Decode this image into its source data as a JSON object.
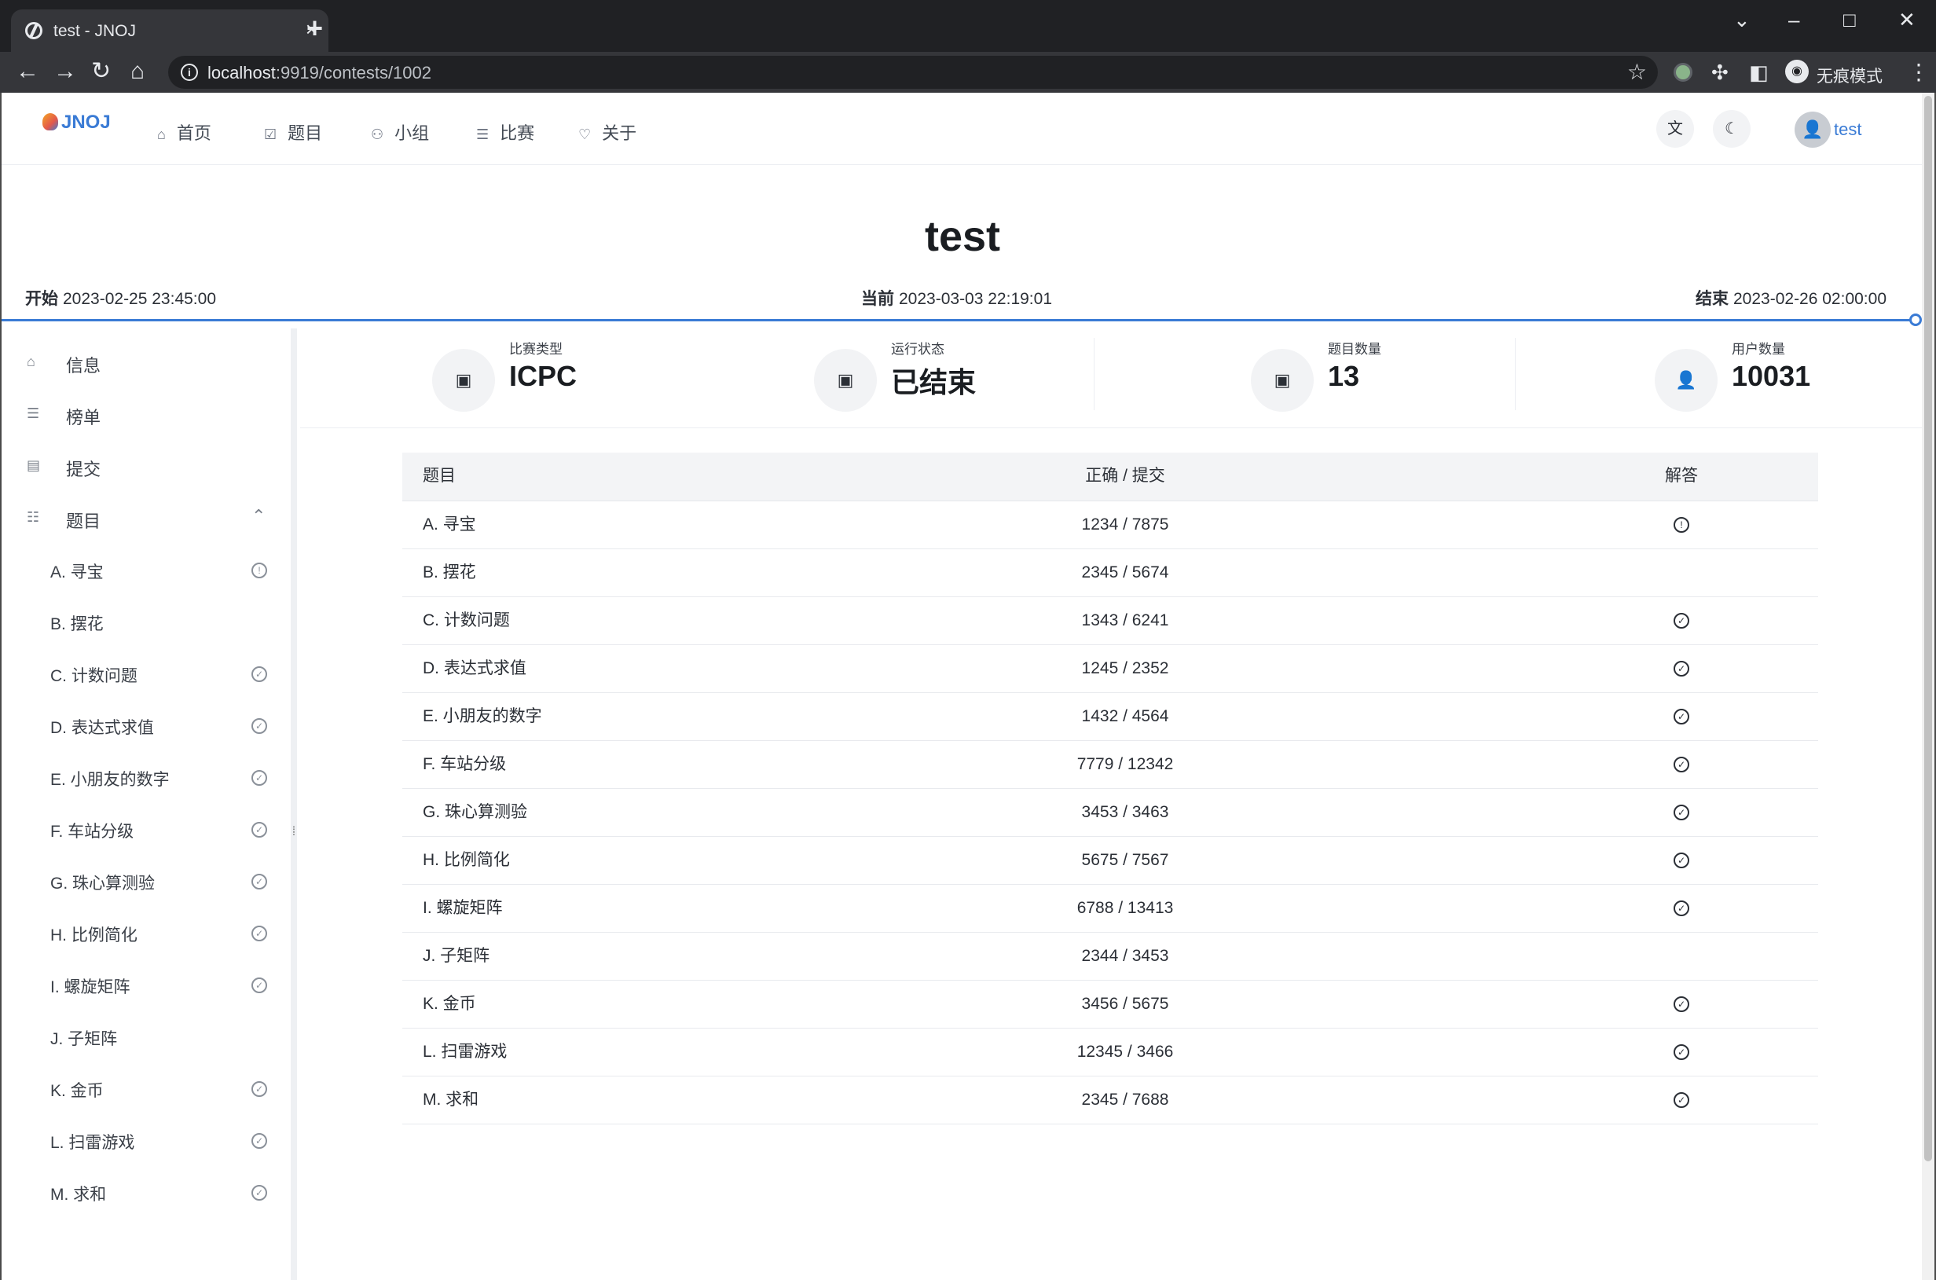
{
  "browser": {
    "tab_title": "test - JNOJ",
    "url_host": "localhost",
    "url_rest": ":9919/contests/1002",
    "incognito_label": "无痕模式"
  },
  "nav": {
    "logo": "JNOJ",
    "items": [
      {
        "label": "首页",
        "icon": "home-icon"
      },
      {
        "label": "题目",
        "icon": "list-check-icon"
      },
      {
        "label": "小组",
        "icon": "group-icon"
      },
      {
        "label": "比赛",
        "icon": "list-icon"
      },
      {
        "label": "关于",
        "icon": "heart-icon"
      }
    ],
    "user": "test"
  },
  "contest": {
    "title": "test",
    "start_label": "开始",
    "start_time": "2023-02-25 23:45:00",
    "current_label": "当前",
    "current_time": "2023-03-03 22:19:01",
    "end_label": "结束",
    "end_time": "2023-02-26 02:00:00"
  },
  "sidebar": {
    "items": [
      {
        "label": "信息",
        "icon": "home-icon"
      },
      {
        "label": "榜单",
        "icon": "list-icon"
      },
      {
        "label": "提交",
        "icon": "document-icon"
      },
      {
        "label": "题目",
        "icon": "list-ordered-icon"
      }
    ],
    "problems": [
      {
        "label": "A. 寻宝",
        "status": "attempted"
      },
      {
        "label": "B. 摆花",
        "status": "none"
      },
      {
        "label": "C. 计数问题",
        "status": "solved"
      },
      {
        "label": "D. 表达式求值",
        "status": "solved"
      },
      {
        "label": "E. 小朋友的数字",
        "status": "solved"
      },
      {
        "label": "F. 车站分级",
        "status": "solved"
      },
      {
        "label": "G. 珠心算测验",
        "status": "solved"
      },
      {
        "label": "H. 比例简化",
        "status": "solved"
      },
      {
        "label": "I. 螺旋矩阵",
        "status": "solved"
      },
      {
        "label": "J. 子矩阵",
        "status": "none"
      },
      {
        "label": "K. 金币",
        "status": "solved"
      },
      {
        "label": "L. 扫雷游戏",
        "status": "solved"
      },
      {
        "label": "M. 求和",
        "status": "solved"
      }
    ]
  },
  "stats": [
    {
      "label": "比赛类型",
      "value": "ICPC"
    },
    {
      "label": "运行状态",
      "value": "已结束"
    },
    {
      "label": "题目数量",
      "value": "13"
    },
    {
      "label": "用户数量",
      "value": "10031"
    }
  ],
  "table": {
    "headers": [
      "题目",
      "正确 / 提交",
      "解答"
    ],
    "rows": [
      {
        "title": "A. 寻宝",
        "ratio": "1234 / 7875",
        "status": "attempted"
      },
      {
        "title": "B. 摆花",
        "ratio": "2345 / 5674",
        "status": "none"
      },
      {
        "title": "C. 计数问题",
        "ratio": "1343 / 6241",
        "status": "solved"
      },
      {
        "title": "D. 表达式求值",
        "ratio": "1245 / 2352",
        "status": "solved"
      },
      {
        "title": "E. 小朋友的数字",
        "ratio": "1432 / 4564",
        "status": "solved"
      },
      {
        "title": "F. 车站分级",
        "ratio": "7779 / 12342",
        "status": "solved"
      },
      {
        "title": "G. 珠心算测验",
        "ratio": "3453 / 3463",
        "status": "solved"
      },
      {
        "title": "H. 比例简化",
        "ratio": "5675 / 7567",
        "status": "solved"
      },
      {
        "title": "I. 螺旋矩阵",
        "ratio": "6788 / 13413",
        "status": "solved"
      },
      {
        "title": "J. 子矩阵",
        "ratio": "2344 / 3453",
        "status": "none"
      },
      {
        "title": "K. 金币",
        "ratio": "3456 / 5675",
        "status": "solved"
      },
      {
        "title": "L. 扫雷游戏",
        "ratio": "12345 / 3466",
        "status": "solved"
      },
      {
        "title": "M. 求和",
        "ratio": "2345 / 7688",
        "status": "solved"
      }
    ]
  },
  "colors": {
    "accent": "#3a7bd5",
    "chrome_dark": "#202124",
    "chrome_tab": "#35363a"
  }
}
